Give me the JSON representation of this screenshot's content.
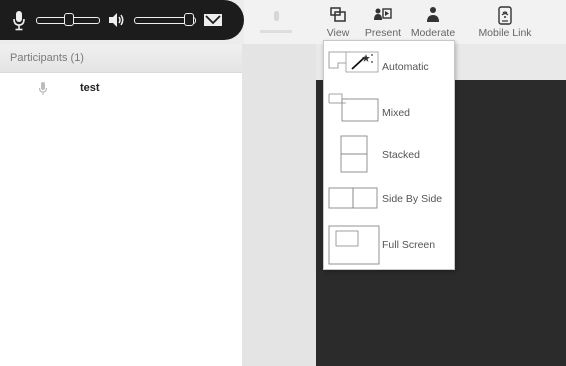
{
  "toolbar": {
    "items": [
      {
        "label": "View",
        "icon": "view-layout-icon"
      },
      {
        "label": "Present",
        "icon": "present-screen-icon"
      },
      {
        "label": "Moderate",
        "icon": "moderate-person-icon"
      },
      {
        "label": "Mobile Link",
        "icon": "mobile-link-icon"
      }
    ],
    "selected": "View"
  },
  "audio_bar": {
    "icons": [
      "microphone-icon",
      "mic-volume-slider",
      "speaker-icon",
      "speaker-volume-slider",
      "camera-off-icon"
    ],
    "mic_level": 0.55,
    "speaker_level": 0.85
  },
  "participants": {
    "header": "Participants (1)",
    "list": [
      {
        "name": "test",
        "icon": "microphone-icon"
      }
    ]
  },
  "view_menu": {
    "items": [
      {
        "label": "Automatic",
        "icon": "magic-wand-layout-icon"
      },
      {
        "label": "Mixed",
        "icon": "mixed-layout-icon"
      },
      {
        "label": "Stacked",
        "icon": "stacked-layout-icon"
      },
      {
        "label": "Side By Side",
        "icon": "side-by-side-layout-icon"
      },
      {
        "label": "Full Screen",
        "icon": "full-screen-layout-icon"
      }
    ]
  },
  "colors": {
    "audio_bar": "#1c1c1c",
    "stage": "#2b2b2b",
    "panel": "#ffffff",
    "toolbar": "#f2f2f2"
  }
}
